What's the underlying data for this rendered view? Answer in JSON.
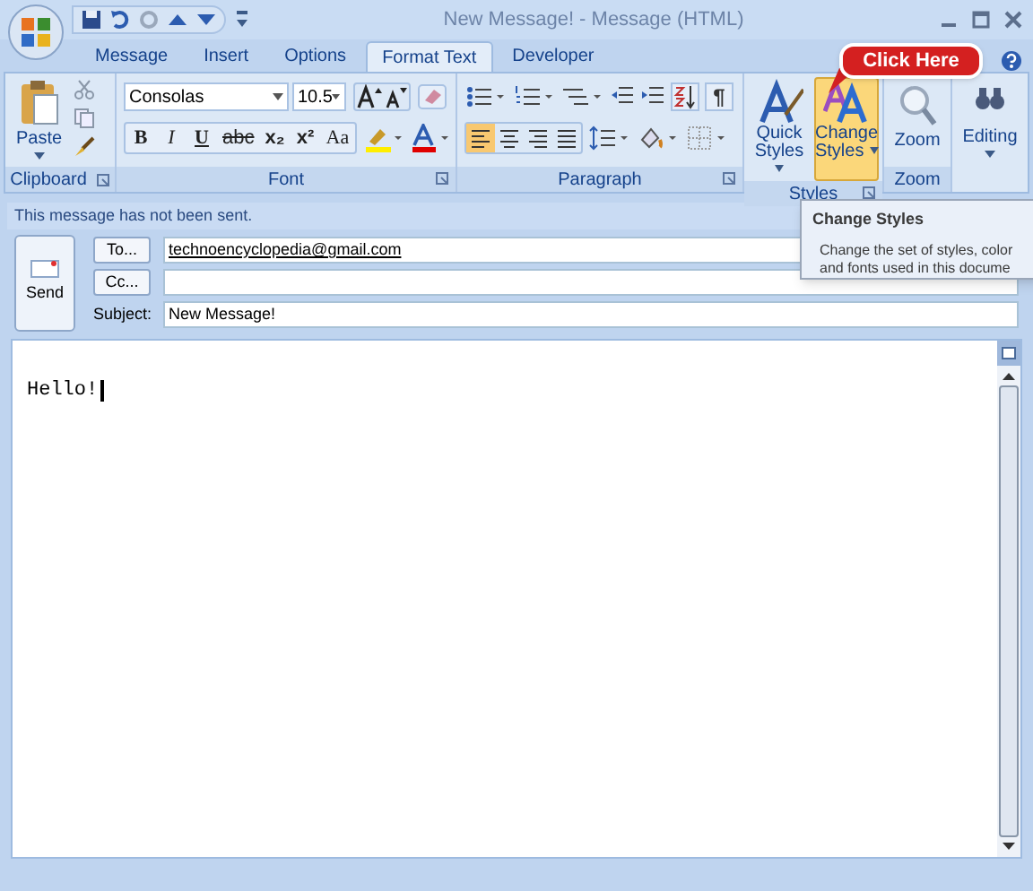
{
  "window": {
    "title": "New Message! - Message (HTML)"
  },
  "tabs": [
    {
      "label": "Message",
      "selected": false
    },
    {
      "label": "Insert",
      "selected": false
    },
    {
      "label": "Options",
      "selected": false
    },
    {
      "label": "Format Text",
      "selected": true
    },
    {
      "label": "Developer",
      "selected": false
    }
  ],
  "ribbon": {
    "clipboard": {
      "paste": "Paste",
      "group": "Clipboard"
    },
    "font": {
      "name": "Consolas",
      "size": "10.5",
      "format_buttons": [
        "B",
        "I",
        "U",
        "abc",
        "x₂",
        "x²",
        "Aa"
      ],
      "group": "Font"
    },
    "paragraph": {
      "pilcrow": "¶",
      "group": "Paragraph"
    },
    "styles": {
      "buttons": [
        {
          "label": "Quick Styles",
          "highlighted": false
        },
        {
          "label": "Change Styles",
          "highlighted": true
        }
      ],
      "group": "Styles"
    },
    "zoom": {
      "button": "Zoom",
      "group": "Zoom"
    },
    "editing": {
      "button": "Editing"
    }
  },
  "callout": "Click Here",
  "info_bar": "This message has not been sent.",
  "send": "Send",
  "to": {
    "button": "To...",
    "value": "technoencyclopedia@gmail.com"
  },
  "cc": {
    "button": "Cc..."
  },
  "subject": {
    "label": "Subject:",
    "value": "New Message!"
  },
  "body": "Hello!",
  "tooltip": {
    "title": "Change Styles",
    "lines": [
      "Change the set of styles, color",
      "and fonts used in this docume"
    ]
  }
}
